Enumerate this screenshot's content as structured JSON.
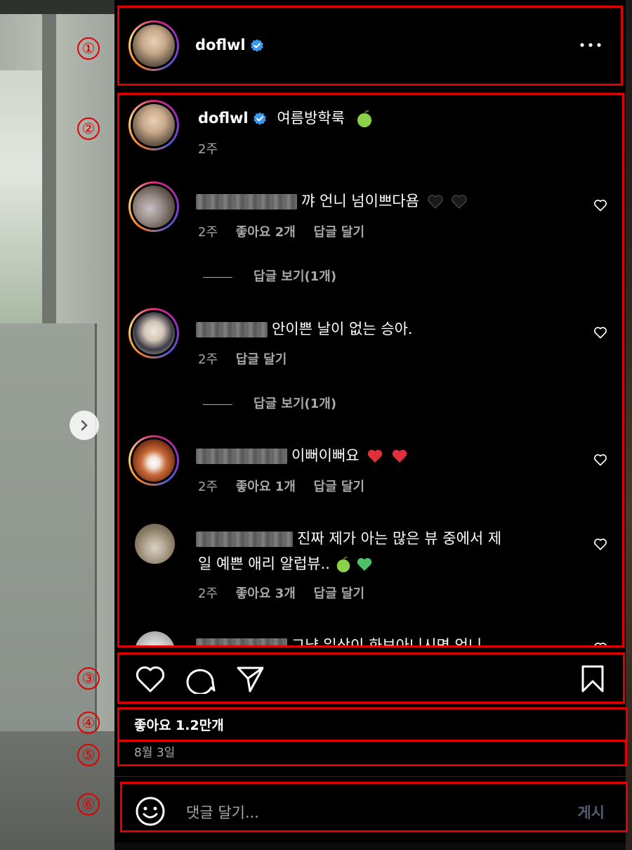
{
  "post": {
    "author": "doflwl",
    "caption": "여름방학룩",
    "caption_time": "2주",
    "likes": "좋아요 1.2만개",
    "date": "8월 3일"
  },
  "comments": [
    {
      "text": "꺄 언니 넘이쁘다욤",
      "time": "2주",
      "likes": "좋아요 2개",
      "reply": "답글 달기",
      "view_replies": "답글 보기(1개)"
    },
    {
      "text": "안이쁜 날이 없는 승아.",
      "time": "2주",
      "likes": "",
      "reply": "답글 달기",
      "view_replies": "답글 보기(1개)"
    },
    {
      "text": "이뻐이뻐요",
      "time": "2주",
      "likes": "좋아요 1개",
      "reply": "답글 달기"
    },
    {
      "text_line1": "진짜 제가 아는 많은 뷰 중에서 제",
      "text_line2": "일 예쁜 애리 알럽뷰..",
      "time": "2주",
      "likes": "좋아요 3개",
      "reply": "답글 달기"
    },
    {
      "text": "그냥 일상이 화보아니시면 언니"
    }
  ],
  "composer": {
    "placeholder": "댓글 달기...",
    "post_label": "게시"
  },
  "annotations": [
    "①",
    "②",
    "③",
    "④",
    "⑤",
    "⑥"
  ],
  "colors": {
    "annotation": "#e00000",
    "verified": "#3897f0",
    "secondary_text": "#a8a8a8",
    "post_button_disabled": "#4d5f73"
  },
  "icons": [
    "verified-badge-icon",
    "more-options-icon",
    "heart-icon",
    "comment-icon",
    "share-icon",
    "bookmark-icon",
    "emoji-icon",
    "chevron-right-icon"
  ]
}
